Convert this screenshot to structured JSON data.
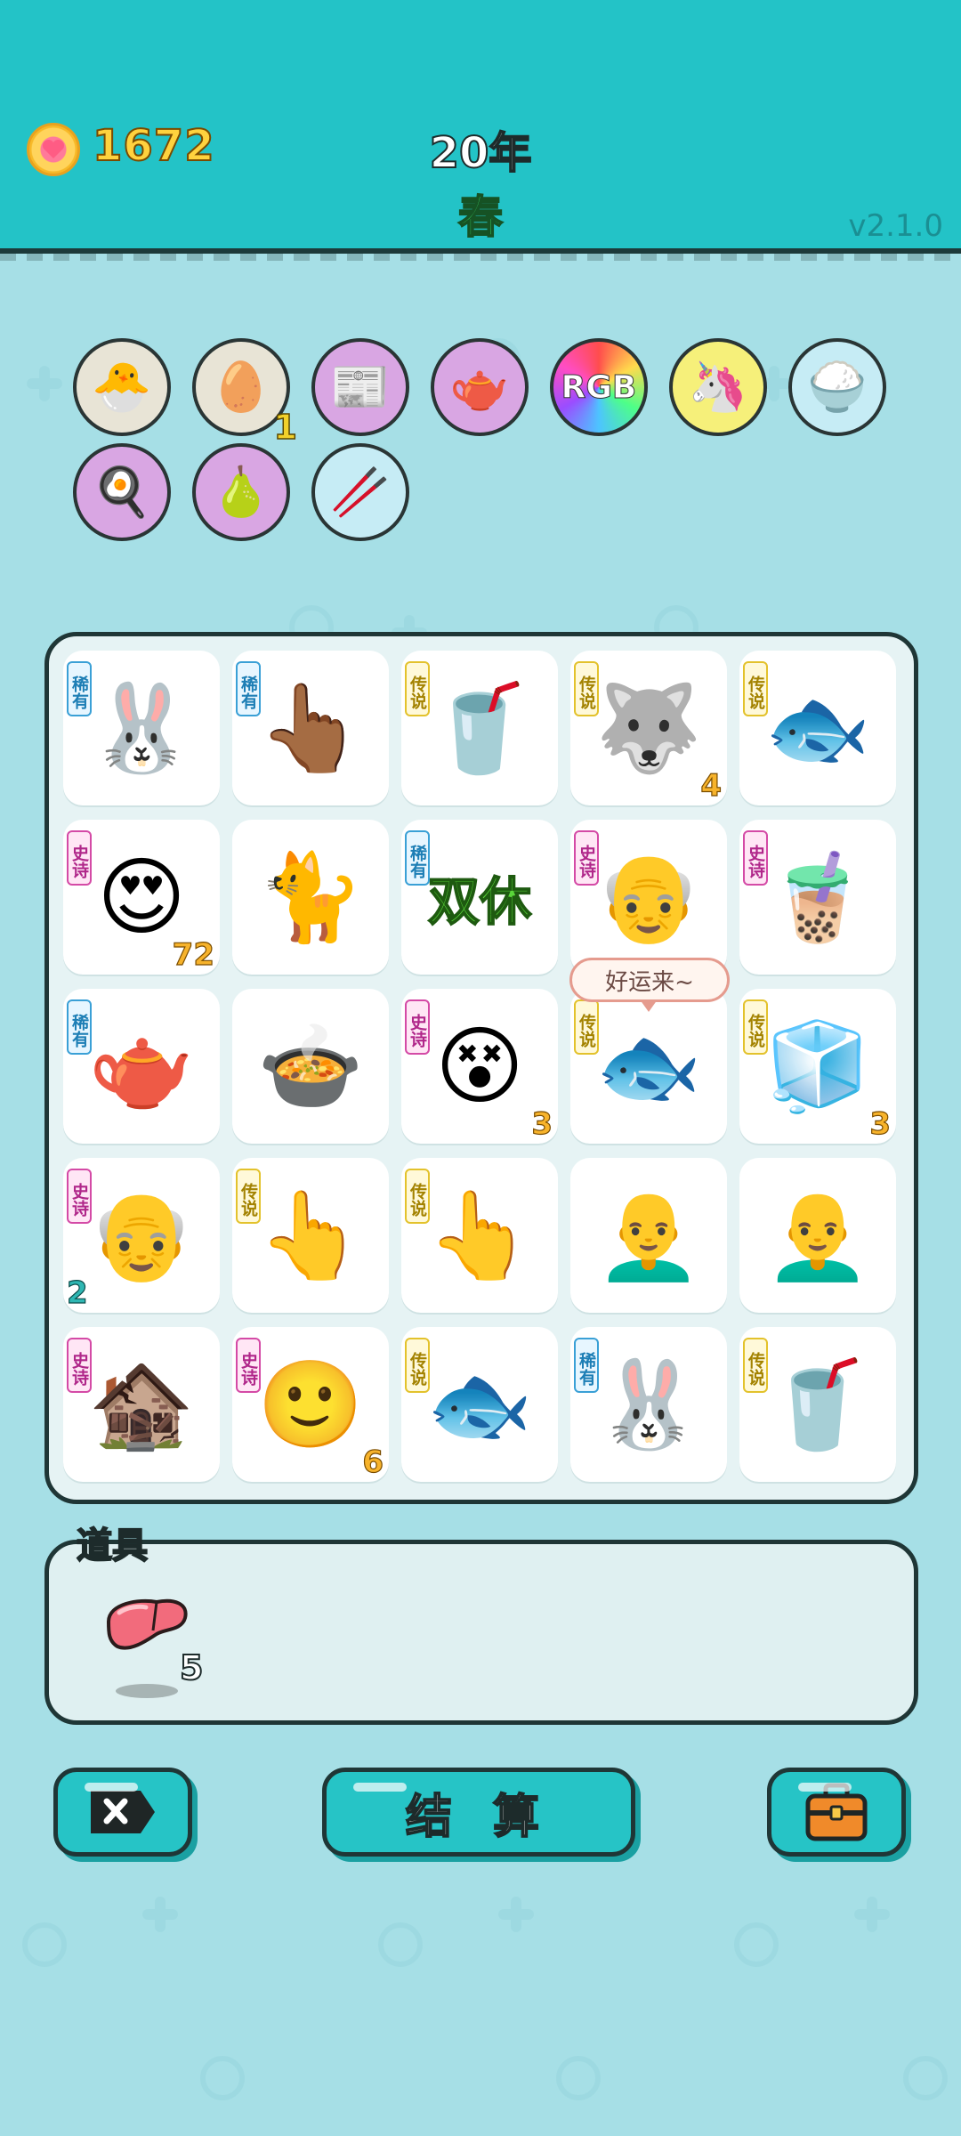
{
  "header": {
    "coins": "1672",
    "year": "20年",
    "season": "春",
    "version": "v2.1.0"
  },
  "collected": [
    {
      "icon": "chick-egg-icon",
      "emoji": "🐣",
      "color": "#e8e4d6",
      "count": ""
    },
    {
      "icon": "egg-carton-icon",
      "emoji": "🥚",
      "color": "#e8e4d6",
      "count": "1"
    },
    {
      "icon": "time-magazine-icon",
      "emoji": "📰",
      "color": "#d9a6e3",
      "count": ""
    },
    {
      "icon": "gravy-boat-icon",
      "emoji": "🫖",
      "color": "#d9a6e3",
      "count": ""
    },
    {
      "icon": "rgb-icon",
      "emoji": "RGB",
      "color": "#ff4d6d",
      "count": ""
    },
    {
      "icon": "unicorn-icon",
      "emoji": "🦄",
      "color": "#f6f07a",
      "count": ""
    },
    {
      "icon": "rice-bowl-icon",
      "emoji": "🍚",
      "color": "#c6ecf5",
      "count": ""
    },
    {
      "icon": "egg-face-icon",
      "emoji": "🍳",
      "color": "#d9a6e3",
      "count": ""
    },
    {
      "icon": "pomelo-icon",
      "emoji": "🍐",
      "color": "#d9a6e3",
      "count": ""
    },
    {
      "icon": "straws-icon",
      "emoji": "🥢",
      "color": "#c6ecf5",
      "count": ""
    }
  ],
  "board": {
    "tags": {
      "rare": "稀有",
      "legend": "传说",
      "epic": "史诗"
    },
    "rows": [
      [
        {
          "name": "rabbit",
          "tag": "rare",
          "emoji": "🐰",
          "count": ""
        },
        {
          "name": "pointing-hand-brown",
          "tag": "rare",
          "emoji": "👆🏾",
          "count": ""
        },
        {
          "name": "bubble-tea-cup",
          "tag": "legend",
          "emoji": "🥤",
          "count": ""
        },
        {
          "name": "husky-king",
          "tag": "legend",
          "emoji": "🐺",
          "count": "4"
        },
        {
          "name": "koi-fish",
          "tag": "legend",
          "emoji": "🐟",
          "count": ""
        }
      ],
      [
        {
          "name": "girl-hearts",
          "tag": "epic",
          "emoji": "😍",
          "count": "72"
        },
        {
          "name": "cat",
          "tag": "",
          "emoji": "🐈",
          "count": ""
        },
        {
          "name": "weekend-sign",
          "tag": "rare",
          "emoji": "双休",
          "count": ""
        },
        {
          "name": "grandpa-hearts",
          "tag": "epic",
          "emoji": "👴",
          "count": ""
        },
        {
          "name": "bubble-tea-glass",
          "tag": "epic",
          "emoji": "🧋",
          "count": ""
        }
      ],
      [
        {
          "name": "teapot",
          "tag": "rare",
          "emoji": "🫖",
          "count": ""
        },
        {
          "name": "soup-bowl",
          "tag": "",
          "emoji": "🍲",
          "count": ""
        },
        {
          "name": "girl-dizzy",
          "tag": "epic",
          "emoji": "😵",
          "count": "3"
        },
        {
          "name": "koi-fish",
          "tag": "legend",
          "emoji": "🐟",
          "count": ""
        },
        {
          "name": "fridge",
          "tag": "legend",
          "emoji": "🧊",
          "count": "3"
        }
      ],
      [
        {
          "name": "grandpa-sad",
          "tag": "epic",
          "emoji": "👴",
          "count": "2"
        },
        {
          "name": "pointing-hand-yellow",
          "tag": "legend",
          "emoji": "👆",
          "count": ""
        },
        {
          "name": "pointing-hand-yellow",
          "tag": "legend",
          "emoji": "👆",
          "count": ""
        },
        {
          "name": "bald-man",
          "tag": "",
          "emoji": "👨‍🦲",
          "count": ""
        },
        {
          "name": "bald-man",
          "tag": "",
          "emoji": "👨‍🦲",
          "count": ""
        }
      ],
      [
        {
          "name": "haunted-house",
          "tag": "epic",
          "emoji": "🏚️",
          "count": ""
        },
        {
          "name": "yellow-face",
          "tag": "epic",
          "emoji": "🙂",
          "count": "6"
        },
        {
          "name": "koi-fish",
          "tag": "legend",
          "emoji": "🐟",
          "count": ""
        },
        {
          "name": "rabbit",
          "tag": "rare",
          "emoji": "🐰",
          "count": ""
        },
        {
          "name": "bubble-tea-cup",
          "tag": "legend",
          "emoji": "🥤",
          "count": ""
        }
      ]
    ]
  },
  "bubble": "好运来~",
  "props": {
    "title": "道具",
    "items": [
      {
        "icon": "liver-icon",
        "count": "5"
      }
    ]
  },
  "buttons": {
    "close_icon": "close-icon",
    "settle_label": "结 算",
    "bag_icon": "briefcase-icon"
  }
}
